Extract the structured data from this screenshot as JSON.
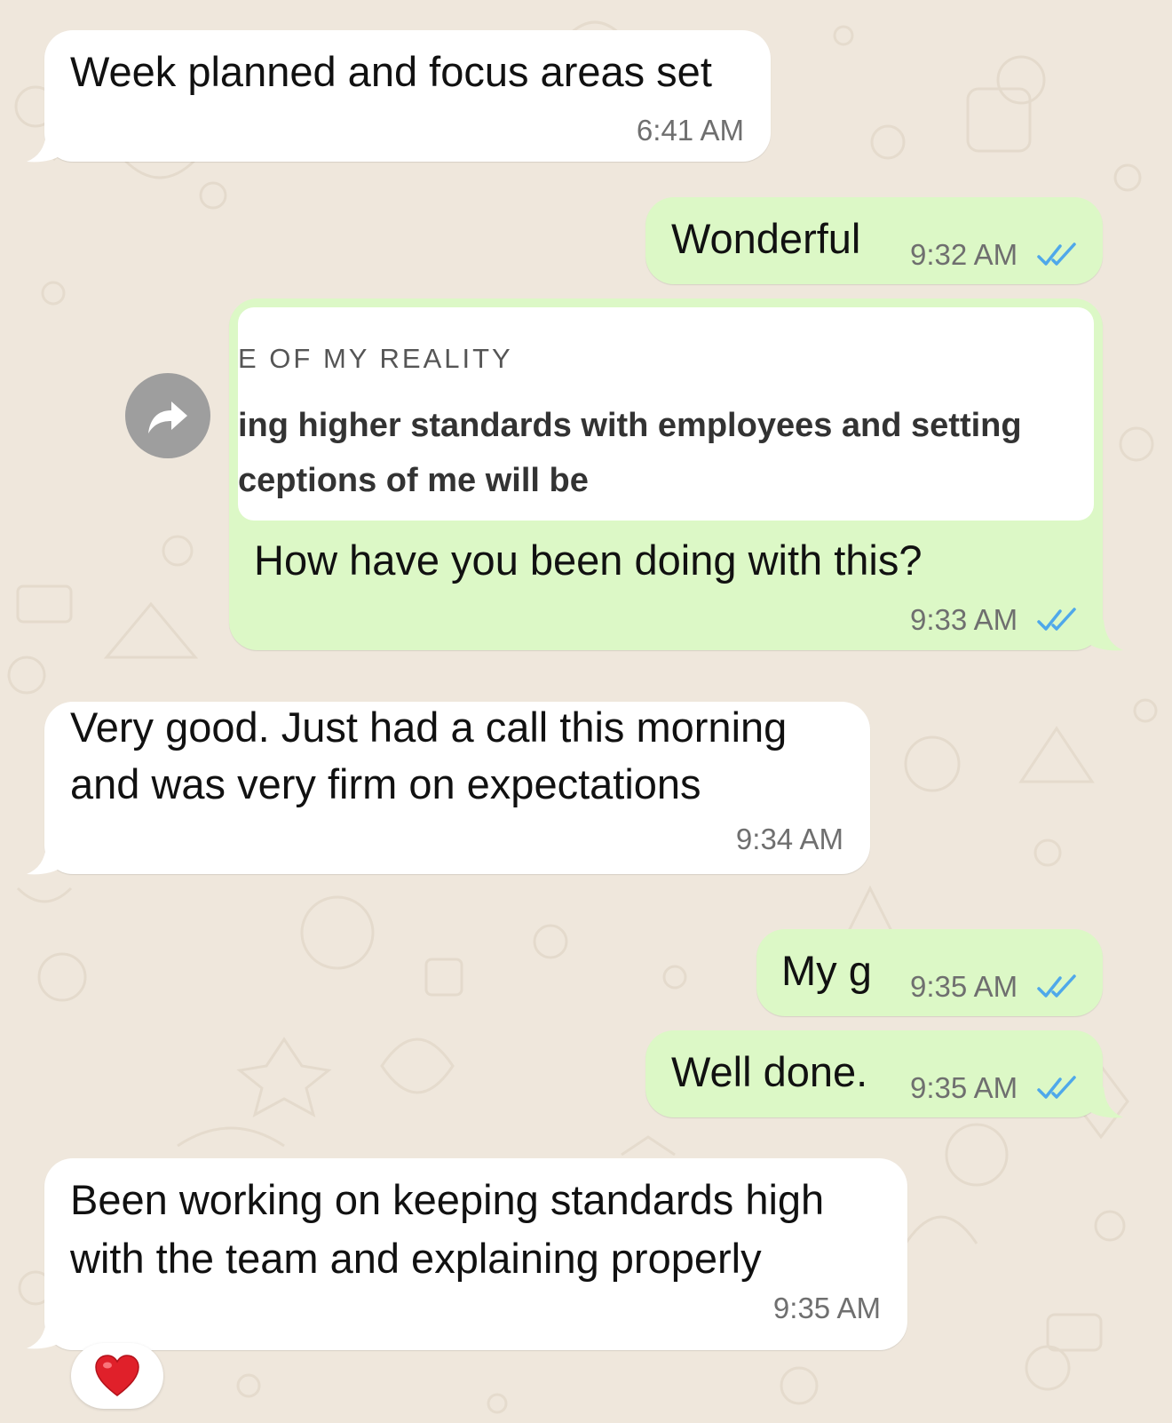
{
  "messages": [
    {
      "id": "m1",
      "direction": "incoming",
      "text": "Week planned and focus areas set",
      "time": "6:41 AM"
    },
    {
      "id": "m2",
      "direction": "outgoing",
      "text": "Wonderful",
      "time": "9:32 AM",
      "status": "read"
    },
    {
      "id": "m3",
      "direction": "outgoing",
      "quote": {
        "line1": "E OF MY REALITY",
        "line2": "ing higher standards with employees and setting",
        "line3": "ceptions of me will be"
      },
      "text": "How have you been doing with this?",
      "time": "9:33 AM",
      "status": "read"
    },
    {
      "id": "m4",
      "direction": "incoming",
      "lines": [
        "Very good. Just had a call this morning",
        "and was very firm on expectations"
      ],
      "time": "9:34 AM"
    },
    {
      "id": "m5",
      "direction": "outgoing",
      "text": "My g",
      "time": "9:35 AM",
      "status": "read"
    },
    {
      "id": "m6",
      "direction": "outgoing",
      "text": "Well done.",
      "time": "9:35 AM",
      "status": "read"
    },
    {
      "id": "m7",
      "direction": "incoming",
      "lines": [
        "Been working on keeping standards high",
        "with the team and explaining properly"
      ],
      "time": "9:35 AM",
      "reaction": "❤️"
    }
  ],
  "colors": {
    "incoming_bubble": "#ffffff",
    "outgoing_bubble": "#dcf8c6",
    "wallpaper": "#efe7dc",
    "read_ticks": "#4fa8ea",
    "timestamp": "#6f6f6f"
  },
  "icons": {
    "forward": "forward-arrow-icon",
    "read_status": "double-check-icon",
    "reaction": "heart-icon"
  }
}
